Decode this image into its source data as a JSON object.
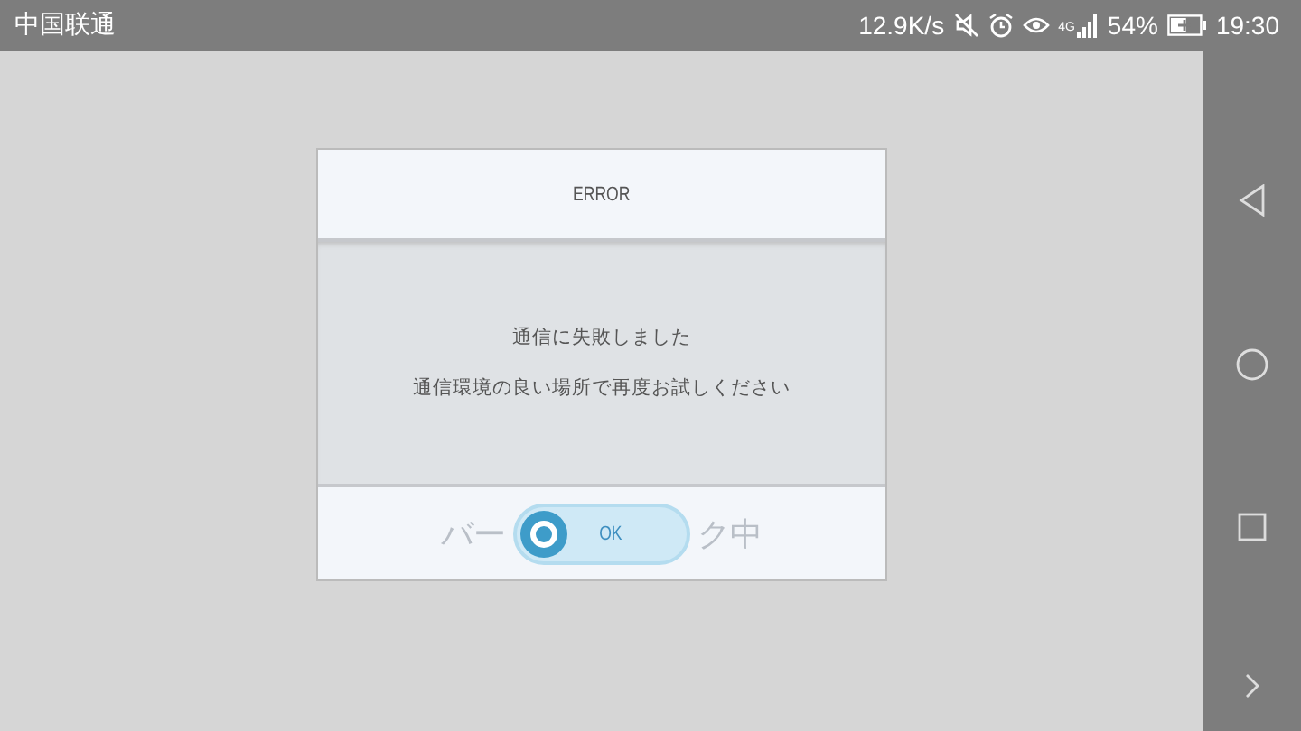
{
  "status_bar": {
    "carrier": "中国联通",
    "speed": "12.9K/s",
    "network": "4G",
    "battery": "54%",
    "battery_charging": true,
    "time": "19:30"
  },
  "dialog": {
    "title": "ERROR",
    "messages": [
      "通信に失敗しました",
      "通信環境の良い場所で再度お試しください"
    ],
    "behind_left": "バー",
    "behind_right": "ク中",
    "button": "OK"
  }
}
